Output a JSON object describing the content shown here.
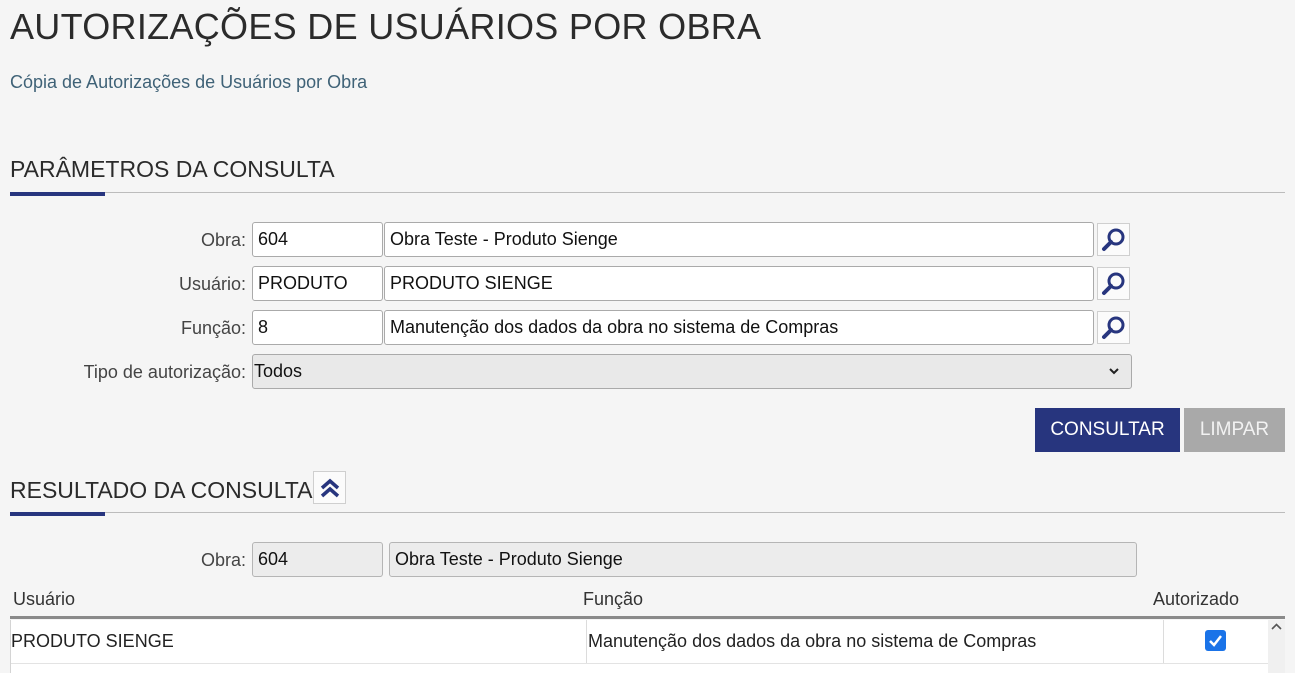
{
  "page": {
    "title": "AUTORIZAÇÕES DE USUÁRIOS POR OBRA",
    "subtitle_link": "Cópia de Autorizações de Usuários por Obra"
  },
  "params": {
    "section_title": "PARÂMETROS DA CONSULTA",
    "obra": {
      "label": "Obra:",
      "code": "604",
      "name": "Obra Teste - Produto Sienge"
    },
    "usuario": {
      "label": "Usuário:",
      "code": "PRODUTO",
      "name": "PRODUTO SIENGE"
    },
    "funcao": {
      "label": "Função:",
      "code": "8",
      "name": "Manutenção dos dados da obra no sistema de Compras"
    },
    "tipo": {
      "label": "Tipo de autorização:",
      "selected": "Todos"
    },
    "consultar_label": "CONSULTAR",
    "limpar_label": "LIMPAR"
  },
  "result": {
    "section_title": "RESULTADO DA CONSULTA",
    "obra": {
      "label": "Obra:",
      "code": "604",
      "name": "Obra Teste - Produto Sienge"
    },
    "columns": {
      "usuario": "Usuário",
      "funcao": "Função",
      "autorizado": "Autorizado"
    },
    "rows": [
      {
        "usuario": "PRODUTO SIENGE",
        "funcao": "Manutenção dos dados da obra no sistema de Compras",
        "autorizado": true
      }
    ]
  },
  "colors": {
    "primary": "#27357e",
    "checkbox": "#1a73e8",
    "link": "#3f6277"
  },
  "icons": [
    "search-icon",
    "double-chevron-up-icon",
    "chevron-down-icon",
    "checkmark-icon",
    "scroll-up-arrow-icon"
  ]
}
